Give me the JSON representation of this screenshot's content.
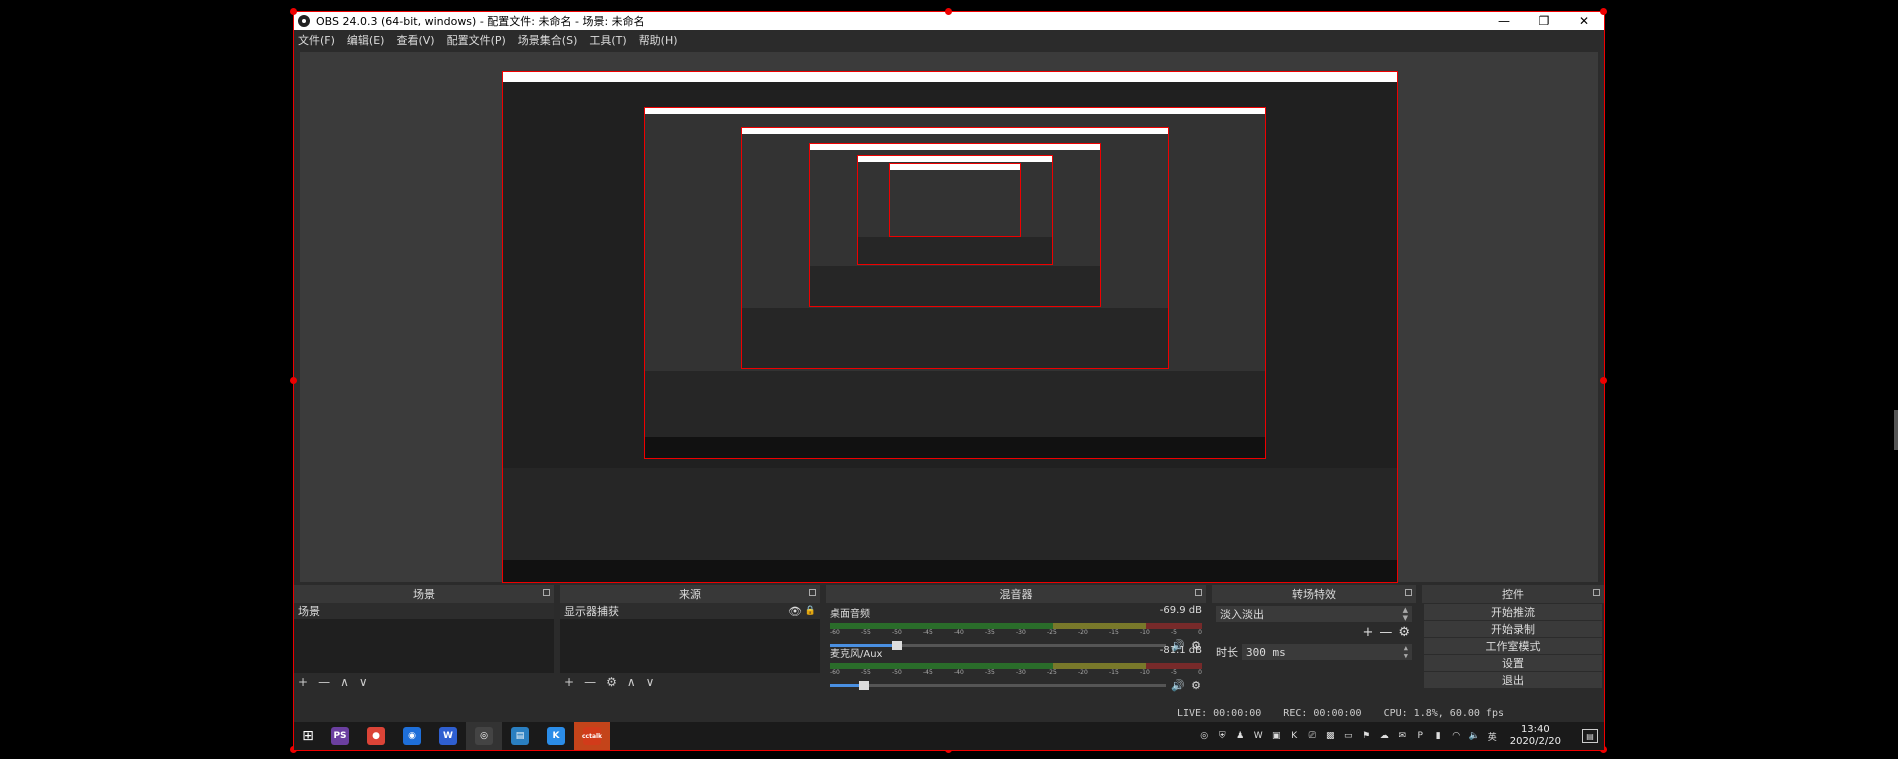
{
  "window": {
    "title": "OBS 24.0.3 (64-bit, windows) - 配置文件: 未命名 - 场景: 未命名",
    "controls": {
      "minimize": "—",
      "maximize": "❐",
      "close": "✕"
    }
  },
  "menu": [
    "文件(F)",
    "编辑(E)",
    "查看(V)",
    "配置文件(P)",
    "场景集合(S)",
    "工具(T)",
    "帮助(H)"
  ],
  "docks": {
    "scenes": {
      "title": "场景",
      "items": [
        "场景"
      ],
      "toolbar": [
        "+",
        "—",
        "∧",
        "∨"
      ]
    },
    "sources": {
      "title": "来源",
      "items": [
        "显示器捕获"
      ],
      "toolbar": [
        "+",
        "—",
        "⚙",
        "∧",
        "∨"
      ]
    },
    "mixer": {
      "title": "混音器",
      "channels": [
        {
          "name": "桌面音频",
          "level": "-69.9 dB",
          "volume": 0.2
        },
        {
          "name": "麦克风/Aux",
          "level": "-81.1 dB",
          "volume": 0.1
        }
      ],
      "ticks": [
        "-60",
        "-55",
        "-50",
        "-45",
        "-40",
        "-35",
        "-30",
        "-25",
        "-20",
        "-15",
        "-10",
        "-5",
        "0"
      ]
    },
    "transitions": {
      "title": "转场特效",
      "selected": "淡入淡出",
      "duration_label": "时长",
      "duration": "300 ms"
    },
    "controls": {
      "title": "控件",
      "buttons": [
        "开始推流",
        "开始录制",
        "工作室模式",
        "设置",
        "退出"
      ]
    }
  },
  "status": {
    "live": "LIVE: 00:00:00",
    "rec": "REC: 00:00:00",
    "cpu": "CPU: 1.8%, 60.00 fps"
  },
  "taskbar": {
    "apps": [
      {
        "name": "photoshop",
        "label": "PS",
        "color": "#6b3fa0"
      },
      {
        "name": "chrome",
        "label": "●",
        "color": "#db4437"
      },
      {
        "name": "maps",
        "label": "◉",
        "color": "#1e6fd9"
      },
      {
        "name": "wps-writer",
        "label": "W",
        "color": "#2f5fd0"
      },
      {
        "name": "obs",
        "label": "◎",
        "color": "#444"
      },
      {
        "name": "reader",
        "label": "▤",
        "color": "#2a7fc1"
      },
      {
        "name": "kugou",
        "label": "K",
        "color": "#2b8de8"
      },
      {
        "name": "cctalk",
        "label": "cctalk",
        "color": "#d23b1a"
      }
    ],
    "clock": {
      "time": "13:40",
      "date": "2020/2/20"
    },
    "ime": "英"
  }
}
